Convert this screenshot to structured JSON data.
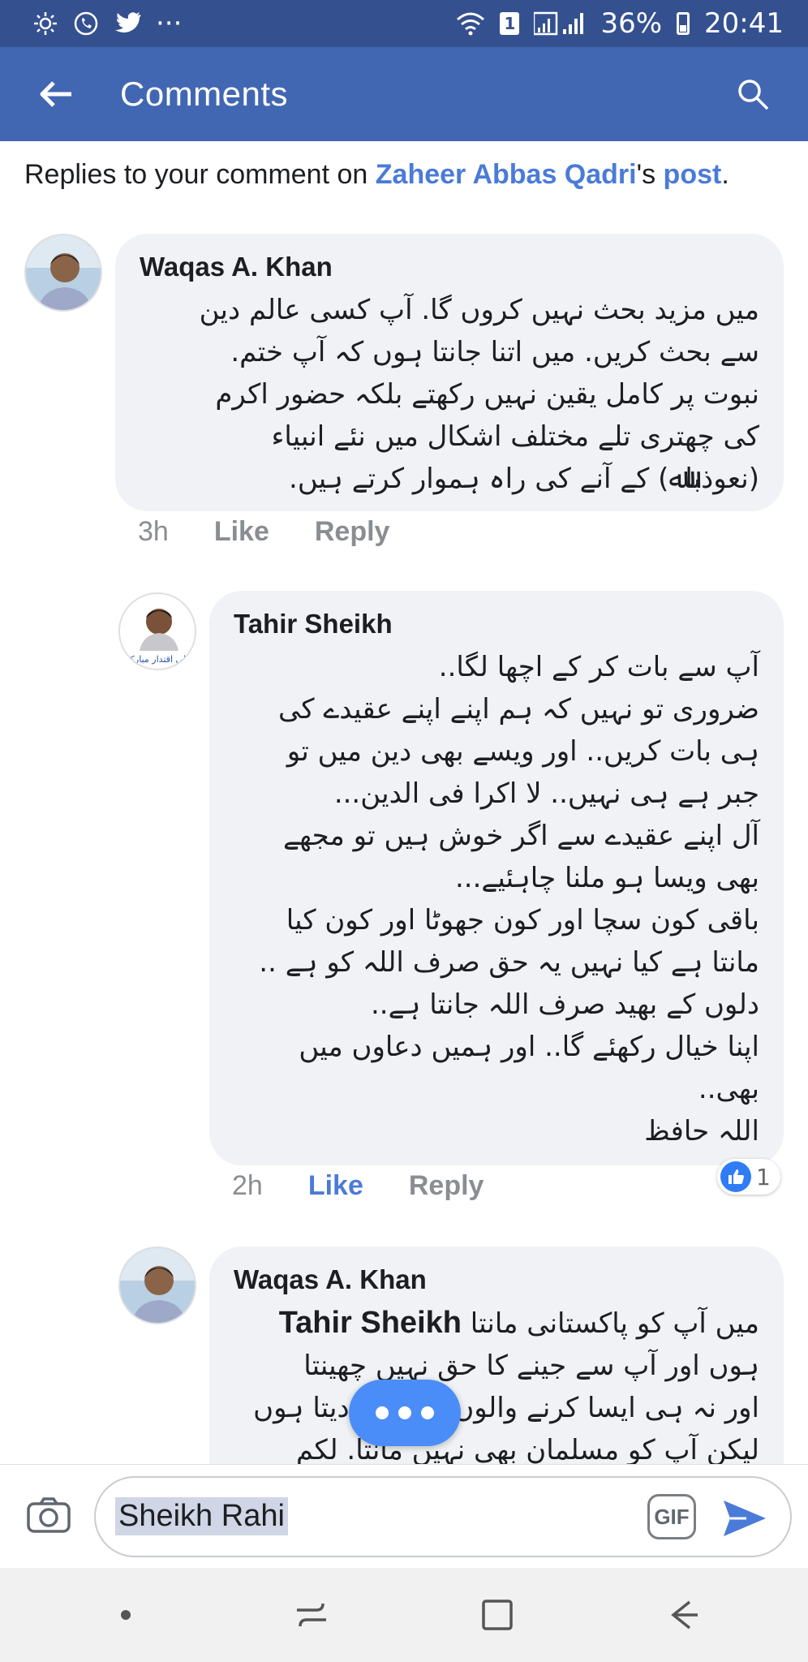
{
  "status_bar": {
    "sim_badge": "1",
    "battery": "36%",
    "time": "20:41",
    "overflow": "···"
  },
  "app_bar": {
    "title": "Comments",
    "back_icon": "back-arrow-icon",
    "search_icon": "search-icon"
  },
  "context": {
    "prefix": "Replies to your comment on ",
    "user": "Zaheer Abbas Qadri",
    "possessive": "'s ",
    "post": "post",
    "suffix": "."
  },
  "comments": [
    {
      "author": "Waqas A. Khan",
      "lines": [
        "میں مزید بحث نہیں کروں گا. آپ کسی عالم دین",
        "سے بحث کریں. میں اتنا جانتا ہوں کہ آپ ختم.",
        "نبوت پر کامل یقین نہیں رکھتے بلکہ حضور اکرم",
        "کی چھتری تلے مختلف اشکال میں نئے انبیاء",
        "(نعوذباﷲ) کے آنے کی راہ ہموار کرتے ہیں."
      ],
      "time": "3h",
      "like": "Like",
      "reply": "Reply"
    },
    {
      "author": "Tahir Sheikh",
      "lines": [
        "آپ سے بات کر کے اچھا لگا..",
        "ضروری تو نہیں کہ ہم اپنے اپنے عقیدے کی",
        "ہی بات کریں.. اور ویسے بھی دین میں تو",
        "جبر ہے ہی نہیں.. لا اکرا فی الدین...",
        "آل اپنے عقیدے سے اگر خوش ہیں تو مجھے",
        "بھی ویسا ہو ملنا چاہئیے...",
        "باقی کون سچا اور کون جھوٹا اور کون کیا",
        "مانتا ہے کیا نہیں یہ حق صرف اللہ کو ہے ..",
        "دلوں کے بھید صرف اللہ جانتا ہے..",
        "اپنا خیال رکھئے گا.. اور ہمیں دعاوں میں",
        "بھی..",
        "اللہ حافظ"
      ],
      "time": "2h",
      "like": "Like",
      "reply": "Reply",
      "reaction_count": "1"
    },
    {
      "author": "Waqas A. Khan",
      "mention": "Tahir Sheikh",
      "first_line": "میں آپ کو پاکستانی مانتا",
      "lines": [
        "ہوں اور آپ سے جینے کا حق نہیں چھینتا",
        "اور نہ ہی ایسا کرنے والوں کا ساتھ دیتا ہوں",
        "لیکن آپ کو مسلمان بھی نہیں مانتا. لکم"
      ]
    }
  ],
  "composer": {
    "input_value": "Sheikh Rahi",
    "gif_label": "GIF"
  },
  "colors": {
    "status_bar": "#34508f",
    "app_bar": "#4267b2",
    "link": "#4b7bd8",
    "bubble": "#f0f2f5"
  }
}
